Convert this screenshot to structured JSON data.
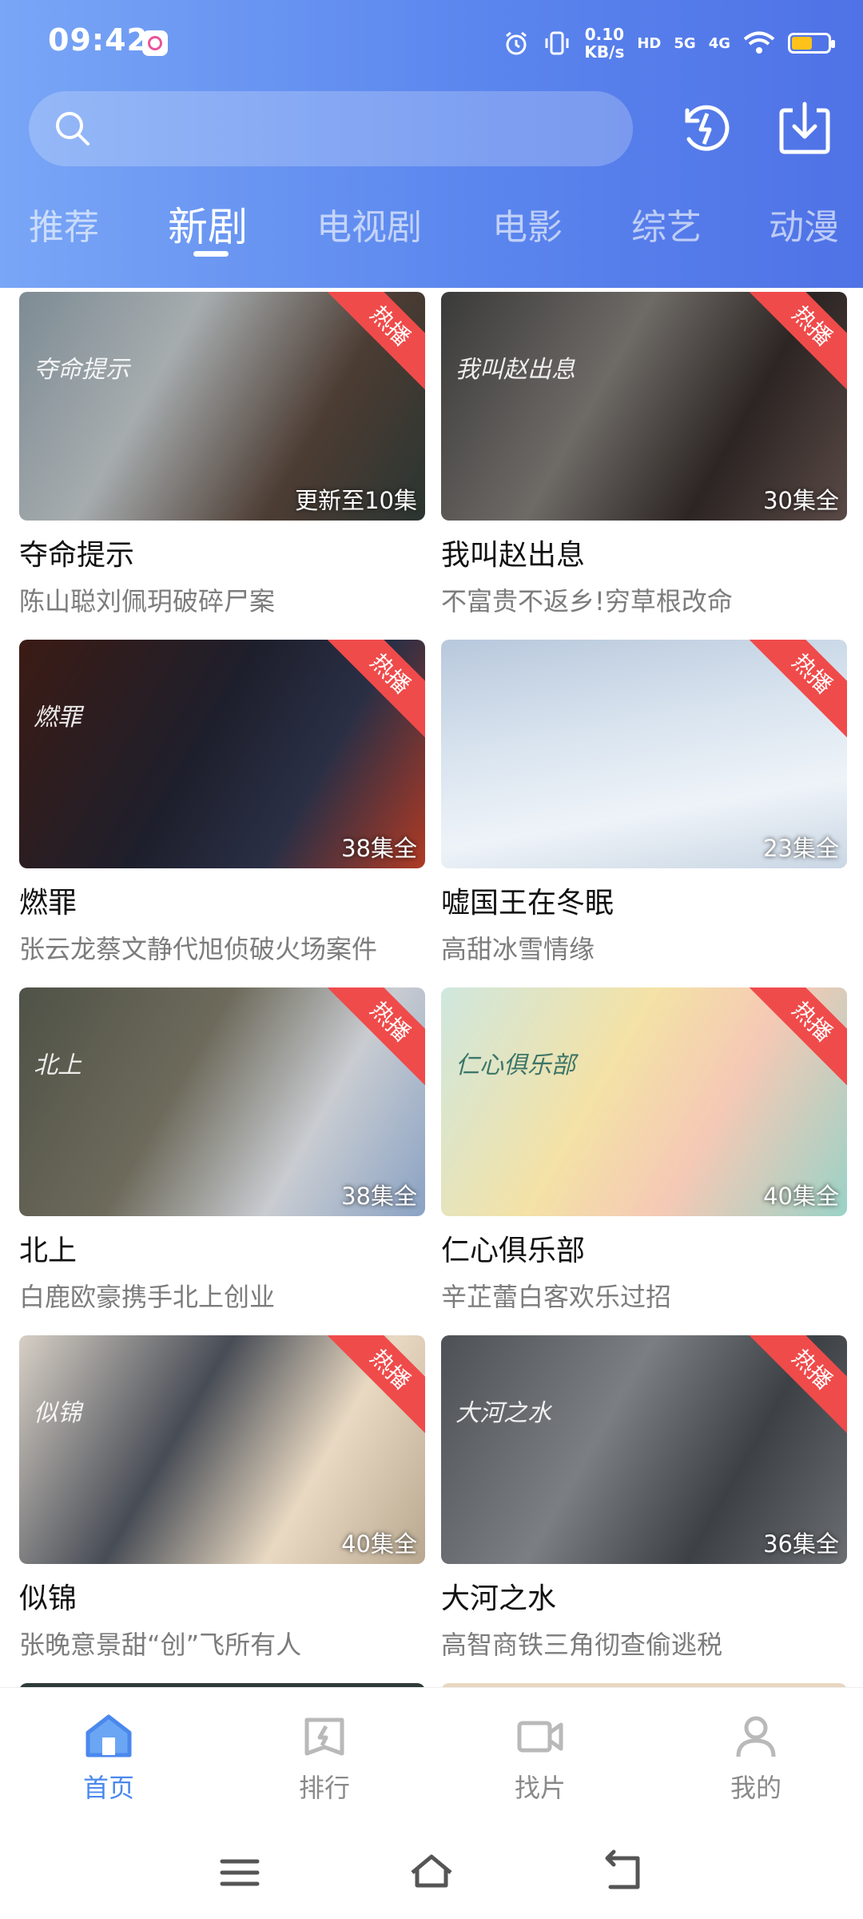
{
  "status_bar": {
    "time": "09:42",
    "net_speed_value": "0.10",
    "net_speed_unit": "KB/s",
    "hd": "HD",
    "sig1": "5G",
    "sig2": "4G"
  },
  "search": {
    "placeholder": ""
  },
  "colors": {
    "accent": "#4a88ee",
    "header_start": "#79a6f6",
    "header_end": "#4f72e6",
    "hot_badge": "#ef4b4b"
  },
  "tabs": [
    {
      "label": "推荐",
      "active": false
    },
    {
      "label": "新剧",
      "active": true
    },
    {
      "label": "电视剧",
      "active": false
    },
    {
      "label": "电影",
      "active": false
    },
    {
      "label": "综艺",
      "active": false
    },
    {
      "label": "动漫",
      "active": false
    }
  ],
  "cards": [
    {
      "title": "夺命提示",
      "subtitle": "陈山聪刘佩玥破碎尸案",
      "badge": "热播",
      "episodes": "更新至10集",
      "poster_text": "夺命提示"
    },
    {
      "title": "我叫赵出息",
      "subtitle": "不富贵不返乡!穷草根改命",
      "badge": "热播",
      "episodes": "30集全",
      "poster_text": "我叫赵出息"
    },
    {
      "title": "燃罪",
      "subtitle": "张云龙蔡文静代旭侦破火场案件",
      "badge": "热播",
      "episodes": "38集全",
      "poster_text": "燃罪"
    },
    {
      "title": "嘘国王在冬眠",
      "subtitle": "高甜冰雪情缘",
      "badge": "热播",
      "episodes": "23集全",
      "poster_text": ""
    },
    {
      "title": "北上",
      "subtitle": "白鹿欧豪携手北上创业",
      "badge": "热播",
      "episodes": "38集全",
      "poster_text": "北上"
    },
    {
      "title": "仁心俱乐部",
      "subtitle": "辛芷蕾白客欢乐过招",
      "badge": "热播",
      "episodes": "40集全",
      "poster_text": "仁心俱乐部"
    },
    {
      "title": "似锦",
      "subtitle": "张晚意景甜“创”飞所有人",
      "badge": "热播",
      "episodes": "40集全",
      "poster_text": "似锦"
    },
    {
      "title": "大河之水",
      "subtitle": "高智商铁三角彻查偷逃税",
      "badge": "热播",
      "episodes": "36集全",
      "poster_text": "大河之水"
    }
  ],
  "bottom_nav": [
    {
      "label": "首页",
      "icon": "home-icon",
      "active": true
    },
    {
      "label": "排行",
      "icon": "ranking-icon",
      "active": false
    },
    {
      "label": "找片",
      "icon": "video-camera-icon",
      "active": false
    },
    {
      "label": "我的",
      "icon": "user-icon",
      "active": false
    }
  ]
}
